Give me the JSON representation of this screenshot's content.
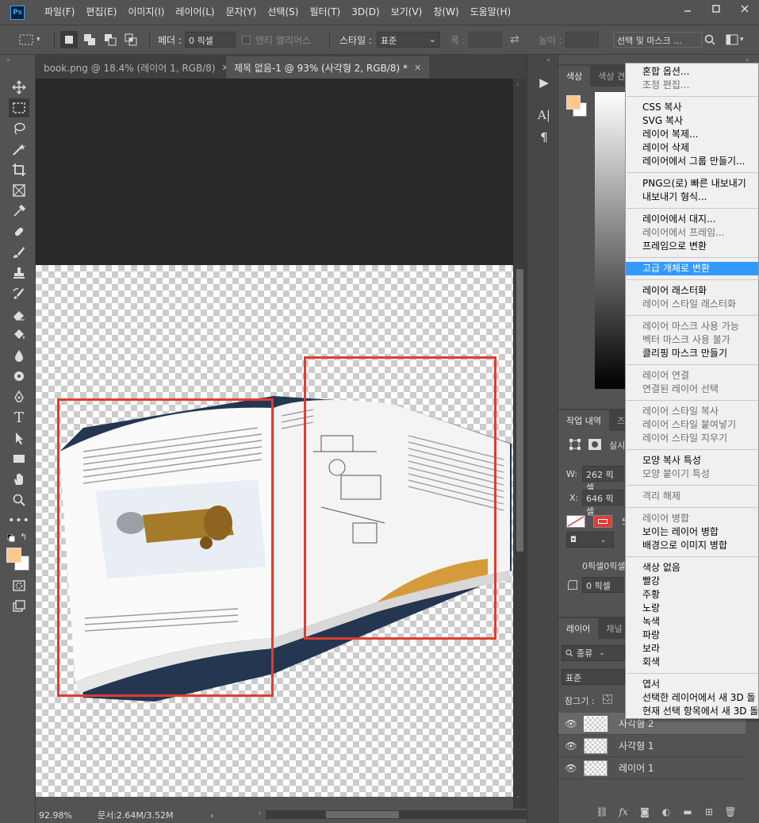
{
  "app": {
    "logo": "Ps",
    "menu": [
      "파일(F)",
      "편집(E)",
      "이미지(I)",
      "레이어(L)",
      "문자(Y)",
      "선택(S)",
      "필터(T)",
      "3D(D)",
      "보기(V)",
      "창(W)",
      "도움말(H)"
    ],
    "window_controls": [
      "minimize",
      "restore",
      "close"
    ]
  },
  "options": {
    "feather_label": "페더 :",
    "feather_value": "0 픽셀",
    "antialias_label": "앤티 앨리어스",
    "style_label": "스타일 :",
    "style_value": "표준",
    "width_label": "폭 :",
    "height_label": "높이 :",
    "select_mask_label": "선택 및 마스크 ..."
  },
  "tabs": [
    {
      "label": "book.png @ 18.4% (레이어 1, RGB/8)",
      "active": false
    },
    {
      "label": "제목 없음-1 @ 93% (사각형 2, RGB/8) *",
      "active": true
    }
  ],
  "status": {
    "zoom": "92.98%",
    "doc": "문서:2.64M/3.52M"
  },
  "panels": {
    "color_tabs": [
      "색상",
      "색상 견"
    ],
    "history_tabs": [
      "작업 내역",
      "즈"
    ],
    "props_label": "실시",
    "w_label": "W:",
    "w_value": "262 픽셀",
    "x_label": "X:",
    "x_value": "646 픽셀",
    "stroke_value": "5",
    "stroke_px": "0픽셀0픽셀",
    "corner_value": "0 픽셀",
    "layers_tabs": [
      "레이어",
      "채널"
    ],
    "filter_label": "종류",
    "blend_mode": "표준",
    "lock_label": "잠그기 :",
    "layers": [
      {
        "name": "사각형 2",
        "selected": true
      },
      {
        "name": "사각형 1",
        "selected": false
      },
      {
        "name": "레이어 1",
        "selected": false
      }
    ]
  },
  "context_menu": {
    "groups": [
      [
        {
          "label": "혼합 옵션...",
          "enabled": true
        },
        {
          "label": "조정 편집...",
          "enabled": false
        }
      ],
      [
        {
          "label": "CSS 복사",
          "enabled": true
        },
        {
          "label": "SVG 복사",
          "enabled": true
        },
        {
          "label": "레이어 복제...",
          "enabled": true
        },
        {
          "label": "레이어 삭제",
          "enabled": true
        },
        {
          "label": "레이어에서 그룹 만들기...",
          "enabled": true
        }
      ],
      [
        {
          "label": "PNG으(로) 빠른 내보내기",
          "enabled": true
        },
        {
          "label": "내보내기 형식...",
          "enabled": true
        }
      ],
      [
        {
          "label": "레이어에서 대지...",
          "enabled": true
        },
        {
          "label": "레이어에서 프레임...",
          "enabled": false
        },
        {
          "label": "프레임으로 변환",
          "enabled": true
        }
      ],
      [
        {
          "label": "고급 개체로 변환",
          "enabled": true,
          "highlight": true
        }
      ],
      [
        {
          "label": "레이어 래스터화",
          "enabled": true
        },
        {
          "label": "레이어 스타일 래스터화",
          "enabled": false
        }
      ],
      [
        {
          "label": "레이어 마스크 사용 가능",
          "enabled": false
        },
        {
          "label": "벡터 마스크 사용 불가",
          "enabled": false
        },
        {
          "label": "클리핑 마스크 만들기",
          "enabled": true
        }
      ],
      [
        {
          "label": "레이어 연결",
          "enabled": false
        },
        {
          "label": "연결된 레이어 선택",
          "enabled": false
        }
      ],
      [
        {
          "label": "레이어 스타일 복사",
          "enabled": false
        },
        {
          "label": "레이어 스타일 붙여넣기",
          "enabled": false
        },
        {
          "label": "레이어 스타일 지우기",
          "enabled": false
        }
      ],
      [
        {
          "label": "모양 복사 특성",
          "enabled": true
        },
        {
          "label": "모양 붙이기 특성",
          "enabled": false
        }
      ],
      [
        {
          "label": "격리 해제",
          "enabled": false
        }
      ],
      [
        {
          "label": "레이어 병합",
          "enabled": false
        },
        {
          "label": "보이는 레이어 병합",
          "enabled": true
        },
        {
          "label": "배경으로 이미지 병합",
          "enabled": true
        }
      ],
      [
        {
          "label": "색상 없음",
          "enabled": true
        },
        {
          "label": "빨강",
          "enabled": true
        },
        {
          "label": "주황",
          "enabled": true
        },
        {
          "label": "노랑",
          "enabled": true
        },
        {
          "label": "녹색",
          "enabled": true
        },
        {
          "label": "파랑",
          "enabled": true
        },
        {
          "label": "보라",
          "enabled": true
        },
        {
          "label": "회색",
          "enabled": true
        }
      ],
      [
        {
          "label": "엽서",
          "enabled": true
        },
        {
          "label": "선택한 레이어에서 새 3D 돌",
          "enabled": true
        },
        {
          "label": "현재 선택 항목에서 새 3D 돌",
          "enabled": true
        }
      ]
    ]
  },
  "colors": {
    "foreground": "#fdc98a",
    "background": "#ffffff",
    "selection_rect": "#e03c31",
    "menu_highlight": "#3399ff",
    "ui_bg": "#535353"
  }
}
